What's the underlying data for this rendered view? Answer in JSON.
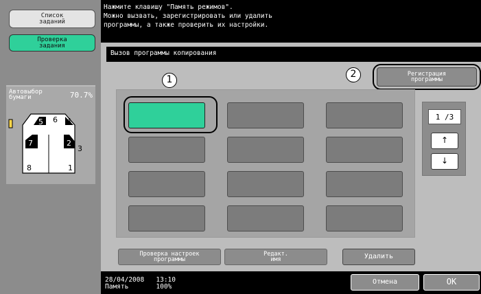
{
  "left_panel": {
    "job_list_label": "Список\nзаданий",
    "job_check_label": "Проверка\nзадания",
    "paper_auto_label": "Автовыбор\nбумаги",
    "zoom": "70.7%",
    "trays": [
      "5",
      "6",
      "4",
      "7",
      "2",
      "3",
      "8",
      "1"
    ]
  },
  "message": {
    "text": "Нажмите клавишу \"Память режимов\".\nМожно вызвать, зарегистрировать или удалить\nпрограммы, а также проверить их настройки."
  },
  "main": {
    "title": "Вызов программы копирования",
    "register_label": "Регистрация\nпрограммы",
    "callout_1": "1",
    "callout_2": "2",
    "page_indicator": "1 /3",
    "up_arrow": "↑",
    "down_arrow": "↓",
    "check_settings_label": "Проверка настроек\nпрограммы",
    "edit_name_label": "Редакт.\nимя",
    "delete_label": "Удалить"
  },
  "bottom": {
    "date": "28/04/2008",
    "time": "13:10",
    "memory_label": "Память",
    "memory_value": "100%",
    "cancel_label": "Отмена",
    "ok_label": "OK"
  },
  "colors": {
    "accent": "#2fd09a",
    "panel": "#8c8c8c",
    "background": "#bdbdbd"
  }
}
